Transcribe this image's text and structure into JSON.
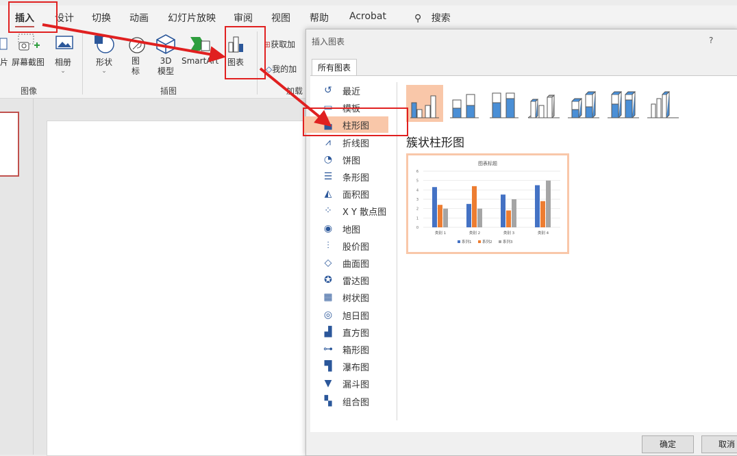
{
  "tabs": [
    "插入",
    "设计",
    "切换",
    "动画",
    "幻灯片放映",
    "审阅",
    "视图",
    "帮助",
    "Acrobat"
  ],
  "search_label": "搜索",
  "ribbon": {
    "btn_pic_partial": "片",
    "btn_screenshot": "屏幕截图",
    "btn_album": "相册",
    "btn_shapes": "形状",
    "btn_icons": "图标",
    "btn_3d": "3D 模型",
    "btn_smartart": "SmartArt",
    "btn_chart": "图表",
    "btn_getaddins": "获取加",
    "btn_myaddins": "我的加",
    "group_images": "图像",
    "group_illustrations": "插图",
    "group_addins": "加载"
  },
  "dialog": {
    "title": "插入图表",
    "help": "?",
    "tab_all": "所有图表",
    "categories": [
      {
        "label": "最近",
        "icon": "recent-icon"
      },
      {
        "label": "模板",
        "icon": "template-icon"
      },
      {
        "label": "柱形图",
        "icon": "column-chart-icon"
      },
      {
        "label": "折线图",
        "icon": "line-chart-icon"
      },
      {
        "label": "饼图",
        "icon": "pie-chart-icon"
      },
      {
        "label": "条形图",
        "icon": "bar-chart-icon"
      },
      {
        "label": "面积图",
        "icon": "area-chart-icon"
      },
      {
        "label": "X Y 散点图",
        "icon": "scatter-chart-icon"
      },
      {
        "label": "地图",
        "icon": "map-chart-icon"
      },
      {
        "label": "股价图",
        "icon": "stock-chart-icon"
      },
      {
        "label": "曲面图",
        "icon": "surface-chart-icon"
      },
      {
        "label": "雷达图",
        "icon": "radar-chart-icon"
      },
      {
        "label": "树状图",
        "icon": "treemap-chart-icon"
      },
      {
        "label": "旭日图",
        "icon": "sunburst-chart-icon"
      },
      {
        "label": "直方图",
        "icon": "histogram-chart-icon"
      },
      {
        "label": "箱形图",
        "icon": "box-chart-icon"
      },
      {
        "label": "瀑布图",
        "icon": "waterfall-chart-icon"
      },
      {
        "label": "漏斗图",
        "icon": "funnel-chart-icon"
      },
      {
        "label": "组合图",
        "icon": "combo-chart-icon"
      }
    ],
    "selected_category": "柱形图",
    "subtype_name": "簇状柱形图",
    "ok": "确定",
    "cancel": "取消"
  },
  "chart_data": {
    "type": "bar",
    "title": "图表标题",
    "categories": [
      "类别 1",
      "类别 2",
      "类别 3",
      "类别 4"
    ],
    "series": [
      {
        "name": "系列1",
        "values": [
          4.3,
          2.5,
          3.5,
          4.5
        ],
        "color": "#4472c4"
      },
      {
        "name": "系列2",
        "values": [
          2.4,
          4.4,
          1.8,
          2.8
        ],
        "color": "#ed7d31"
      },
      {
        "name": "系列3",
        "values": [
          2.0,
          2.0,
          3.0,
          5.0
        ],
        "color": "#a5a5a5"
      }
    ],
    "ylim": [
      0,
      6
    ],
    "yticks": [
      "0",
      "1",
      "2",
      "3",
      "4",
      "5",
      "6"
    ],
    "grid": true,
    "legend": "bottom"
  },
  "colors": {
    "accent_red": "#e02020",
    "selection": "#f9c7a9"
  }
}
